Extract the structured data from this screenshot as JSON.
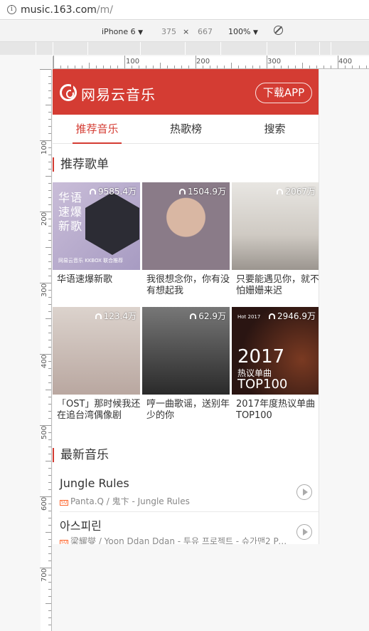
{
  "browser": {
    "url_host": "music.163.com",
    "url_path": "/m/"
  },
  "device_toolbar": {
    "device": "iPhone 6",
    "width": "375",
    "times": "×",
    "height": "667",
    "zoom": "100%"
  },
  "rulers": {
    "h_labels": [
      "100",
      "200",
      "300",
      "400"
    ],
    "v_labels": [
      "100",
      "200",
      "300",
      "400",
      "500",
      "600",
      "700"
    ]
  },
  "header": {
    "logo_text": "网易云音乐",
    "download_label": "下载APP",
    "brand_color": "#d43c33"
  },
  "tabs": [
    {
      "label": "推荐音乐",
      "active": true
    },
    {
      "label": "热歌榜",
      "active": false
    },
    {
      "label": "搜索",
      "active": false
    }
  ],
  "recommend": {
    "title": "推荐歌单",
    "playlists": [
      {
        "count": "9585.4万",
        "caption": "华语速爆新歌",
        "cover_text": "华语\n速爆\n新歌",
        "cover_tag": "网易云音乐 KKBOX 联合推荐"
      },
      {
        "count": "1504.9万",
        "caption": "我很想念你，你有没有想起我"
      },
      {
        "count": "2067万",
        "caption": "只要能遇见你，就不怕姗姗来迟"
      },
      {
        "count": "123.4万",
        "caption": "「OST」那时候我还在追台湾偶像剧"
      },
      {
        "count": "62.9万",
        "caption": "哼一曲歌谣，送别年少的你"
      },
      {
        "count": "2946.9万",
        "caption": "2017年度热议单曲TOP100",
        "cover_year": "2017",
        "cover_sub": "热议单曲",
        "cover_top": "TOP100",
        "cover_hot": "Hot 2017"
      }
    ]
  },
  "newsongs": {
    "title": "最新音乐",
    "songs": [
      {
        "name": "Jungle Rules",
        "badge": "SQ",
        "meta": "Panta.Q / 鬼卞 - Jungle Rules"
      },
      {
        "name": "아스피린",
        "badge": "SQ",
        "meta": "梁耀燮 / Yoon Ddan Ddan - 투유 프로젝트 - 슈가맨2 Pa..."
      }
    ]
  }
}
